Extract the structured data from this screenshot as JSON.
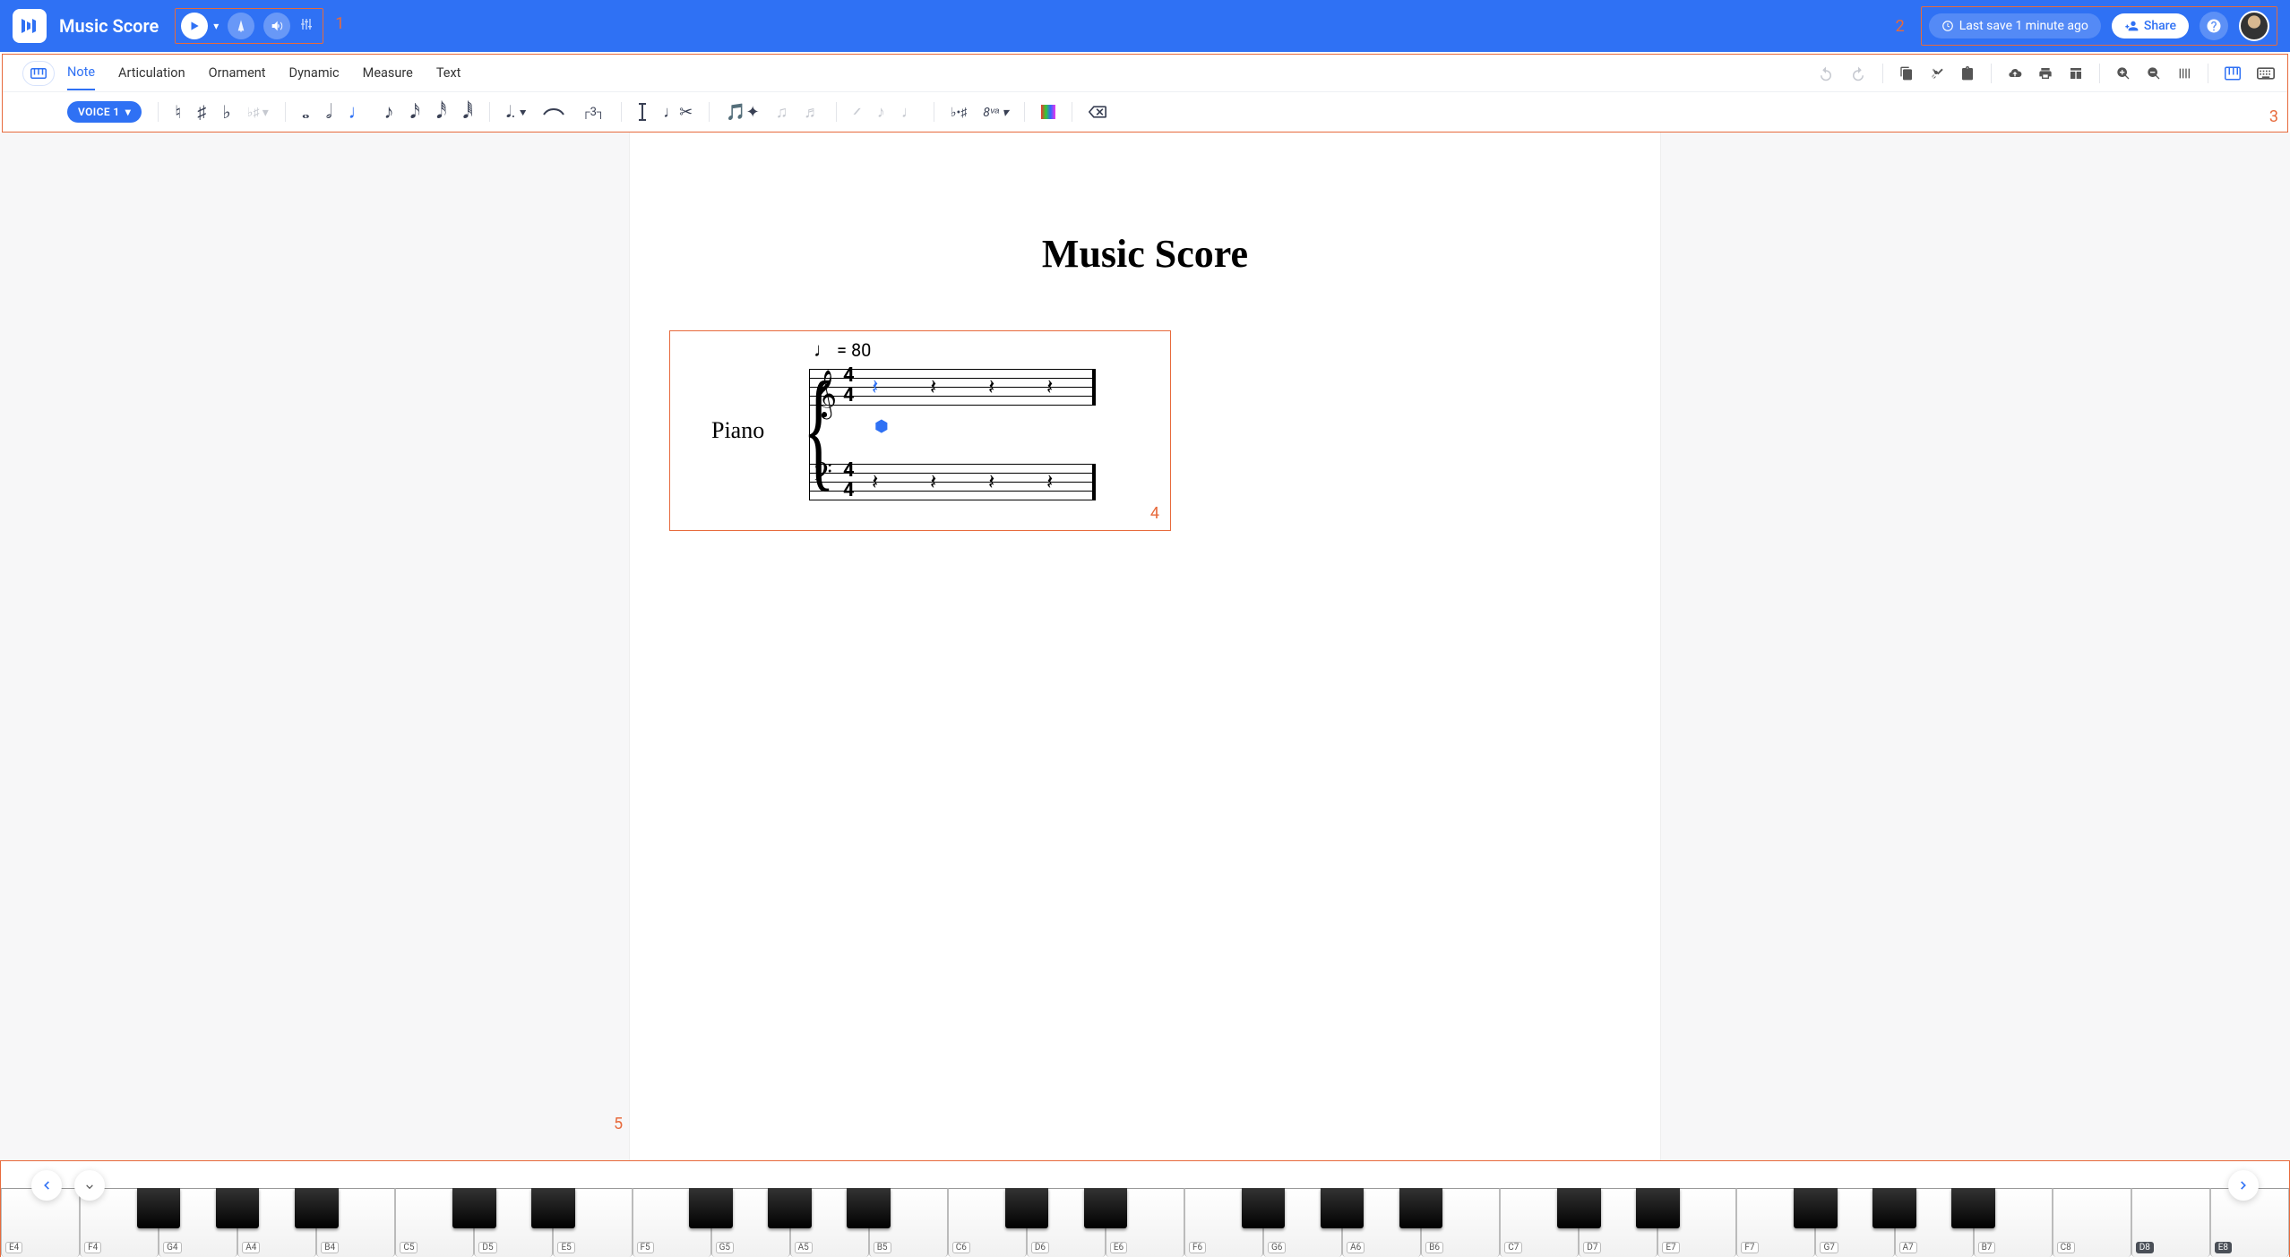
{
  "header": {
    "app_title": "Music Score",
    "last_save": "Last save 1 minute ago",
    "share_label": "Share"
  },
  "annotations": {
    "a1": "1",
    "a2": "2",
    "a3": "3",
    "a4": "4",
    "a5": "5"
  },
  "tabs": {
    "items": [
      "Note",
      "Articulation",
      "Ornament",
      "Dynamic",
      "Measure",
      "Text"
    ],
    "active_index": 0
  },
  "voice_pill": "VOICE 1",
  "accidentals": [
    "♮",
    "♯",
    "♭"
  ],
  "score": {
    "title": "Music Score",
    "tempo_value": "= 80",
    "tempo_note": "♩",
    "instrument": "Piano",
    "time_sig_top": "4",
    "time_sig_bot": "4",
    "treble_clef": "𝄞",
    "bass_clef": "𝄢",
    "rest_glyph": "𝄽"
  },
  "piano": {
    "white_keys": [
      "E4",
      "F4",
      "G4",
      "A4",
      "B4",
      "C5",
      "D5",
      "E5",
      "F5",
      "G5",
      "A5",
      "B5",
      "C6",
      "D6",
      "E6",
      "F6",
      "G6",
      "A6",
      "B6",
      "C7",
      "D7",
      "E7",
      "F7",
      "G7",
      "A7",
      "B7",
      "C8",
      "D8",
      "E8"
    ],
    "dark_labels": [
      "D8",
      "E8"
    ],
    "black_after": [
      "F4",
      "G4",
      "A4",
      "C5",
      "D5",
      "F5",
      "G5",
      "A5",
      "C6",
      "D6",
      "F6",
      "G6",
      "A6",
      "C7",
      "D7",
      "F7",
      "G7",
      "A7"
    ]
  }
}
